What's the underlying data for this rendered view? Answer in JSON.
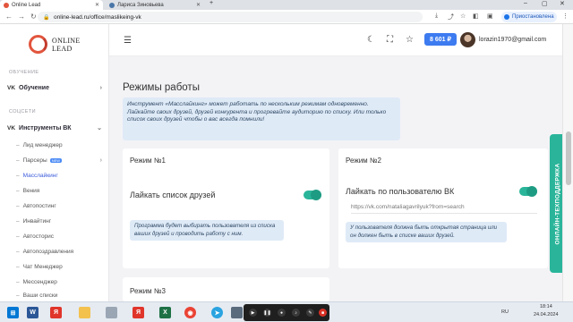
{
  "browser": {
    "tabs": [
      {
        "title": "Online Lead",
        "active": true
      },
      {
        "title": "Лариса Зиновьева",
        "active": false
      }
    ],
    "url": "online-lead.ru/office/maslikeing-vk",
    "profile_status": "Приостановлена"
  },
  "app": {
    "logo_line1": "ONLINE",
    "logo_line2": "LEAD",
    "balance": "8 601 ₽",
    "user_email": "lorazin1970@gmail.com"
  },
  "sidebar": {
    "section_training": "ОБУЧЕНИЕ",
    "training_item": "Обучение",
    "section_social": "СОЦСЕТИ",
    "vk_tools": "Инструменты ВК",
    "sub_items": [
      {
        "label": "Лид менеджер"
      },
      {
        "label": "Парсеры",
        "badge": "NEW"
      },
      {
        "label": "Масслайкинг",
        "active": true
      },
      {
        "label": "Вения"
      },
      {
        "label": "Автопостинг"
      },
      {
        "label": "Инвайтинг"
      },
      {
        "label": "Автосторис"
      },
      {
        "label": "Автопоздравления"
      },
      {
        "label": "Чат Менеджер"
      },
      {
        "label": "Мессенджер"
      },
      {
        "label": "Ваши списки"
      }
    ]
  },
  "main": {
    "title": "Режимы работы",
    "intro": "Инструмент «Масслайкинг» может работать по нескольким режимам одновременно.\nЛайкайте своих друзей, друзей конкурента и прогревайте аудиторию по списку. Или только список своих друзей чтобы о вас всегда помнили!",
    "mode1": {
      "title": "Режим №1",
      "label": "Лайкать список друзей",
      "note": "Программа будет выбирать пользователя из списка ваших друзей и проводить работу с ним."
    },
    "mode2": {
      "title": "Режим №2",
      "label": "Лайкать по пользователю ВК",
      "url_value": "https://vk.com/nataliagavrilyuk?from=search",
      "note": "У пользователя должна быть открытая страница или он должен быть в списке ваших друзей."
    },
    "mode3": {
      "title": "Режим №3"
    }
  },
  "support_tab": "ОНЛАЙН-ТЕХПОДДЕРЖКА",
  "taskbar": {
    "lang": "RU",
    "time": "18:14",
    "date": "24.04.2024"
  }
}
